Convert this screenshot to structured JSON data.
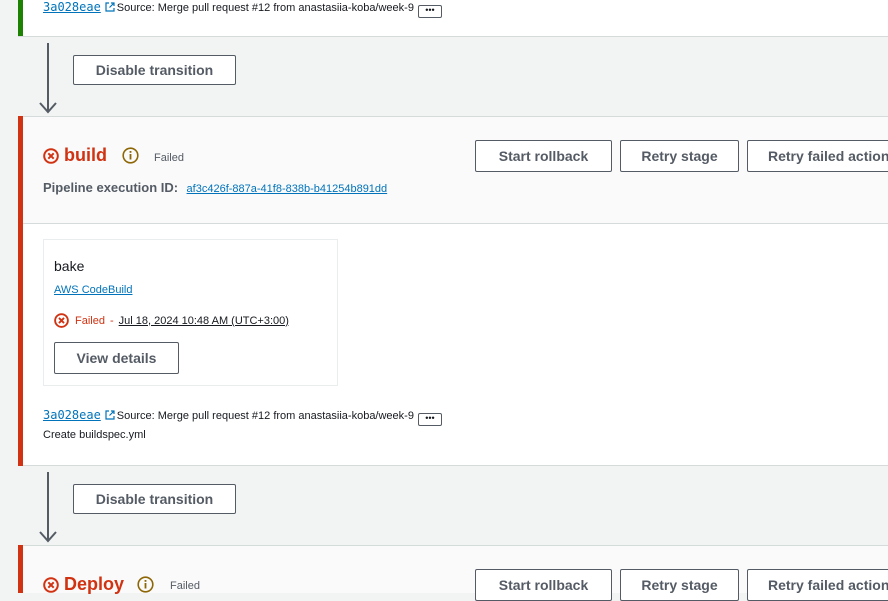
{
  "top_source": {
    "commit_id": "3a028eae",
    "source_text": "Source: Merge pull request #12 from anastasiia-koba/week-9",
    "more_label": "•••"
  },
  "transitions": [
    {
      "button_label": "Disable transition"
    },
    {
      "button_label": "Disable transition"
    }
  ],
  "build_stage": {
    "name": "build",
    "status": "Failed",
    "execution_label": "Pipeline execution ID:",
    "execution_id": "af3c426f-887a-41f8-838b-b41254b891dd",
    "buttons": {
      "rollback": "Start rollback",
      "retry_stage": "Retry stage",
      "retry_failed": "Retry failed action"
    },
    "action": {
      "name": "bake",
      "provider": "AWS CodeBuild",
      "status": "Failed",
      "separator": "-",
      "timestamp": "Jul 18, 2024 10:48 AM (UTC+3:00)",
      "details_button": "View details"
    },
    "source": {
      "commit_id": "3a028eae",
      "source_text": "Source: Merge pull request #12 from anastasiia-koba/week-9",
      "more_label": "•••",
      "commit_message": "Create buildspec.yml"
    }
  },
  "deploy_stage": {
    "name": "Deploy",
    "status": "Failed",
    "buttons": {
      "rollback": "Start rollback",
      "retry_stage": "Retry stage",
      "retry_failed": "Retry failed action"
    }
  },
  "colors": {
    "failed": "#d13212",
    "success": "#1d8102",
    "link": "#0073bb",
    "info": "#8d6605"
  }
}
